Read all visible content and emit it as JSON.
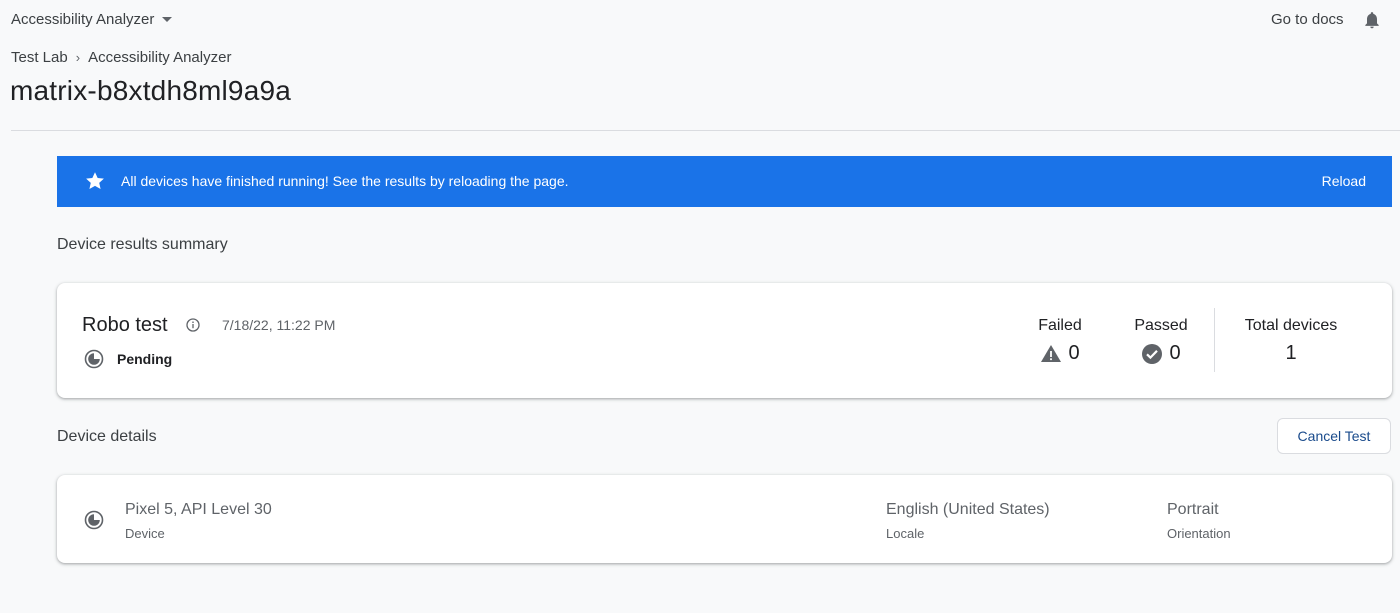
{
  "app": {
    "project_name": "Accessibility Analyzer",
    "docs_link": "Go to docs"
  },
  "breadcrumb": {
    "parent": "Test Lab",
    "current": "Accessibility Analyzer"
  },
  "page_title": "matrix-b8xtdh8ml9a9a",
  "banner": {
    "message": "All devices have finished running! See the results by reloading the page.",
    "action": "Reload",
    "color": "#1a73e8"
  },
  "summary": {
    "section_title": "Device results summary",
    "test_name": "Robo test",
    "timestamp": "7/18/22, 11:22 PM",
    "status": "Pending",
    "failed_label": "Failed",
    "failed_count": "0",
    "passed_label": "Passed",
    "passed_count": "0",
    "total_label": "Total devices",
    "total_count": "1"
  },
  "details": {
    "section_title": "Device details",
    "cancel_button": "Cancel Test",
    "device_value": "Pixel 5, API Level 30",
    "device_label": "Device",
    "locale_value": "English (United States)",
    "locale_label": "Locale",
    "orientation_value": "Portrait",
    "orientation_label": "Orientation"
  },
  "icons": {
    "caret": "chevron-down-icon",
    "notifications": "bell-icon",
    "banner": "star-icon",
    "info": "info-icon",
    "status": "pending-icon",
    "failed": "warning-icon",
    "passed": "check-circle-icon"
  }
}
